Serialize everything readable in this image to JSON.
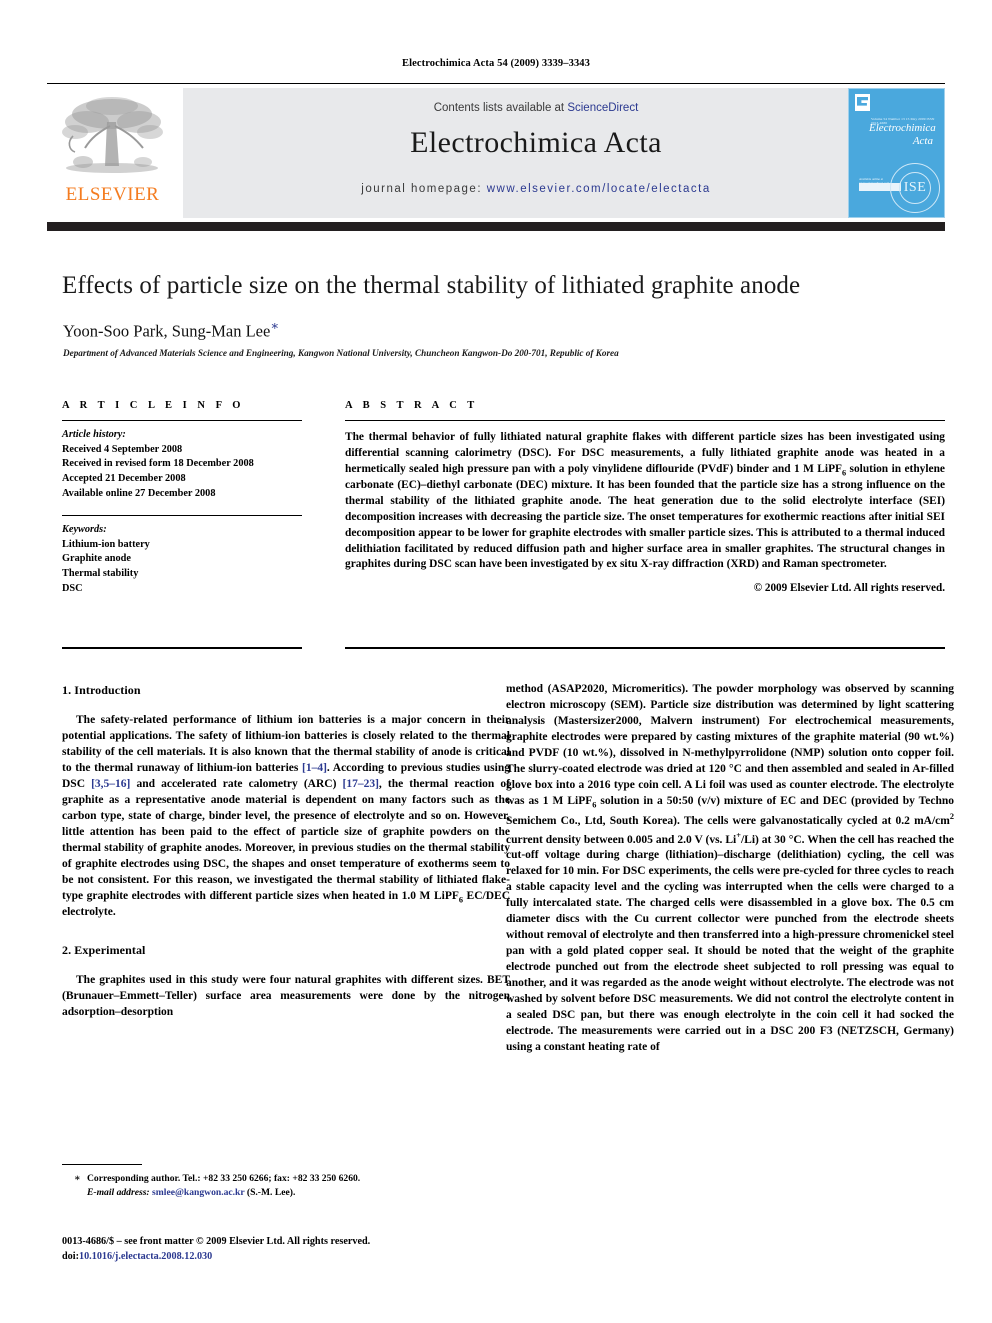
{
  "running_head": "Electrochimica Acta 54 (2009) 3339–3343",
  "masthead": {
    "contents_prefix": "Contents lists available at ",
    "sciencedirect": "ScienceDirect",
    "journal_name": "Electrochimica Acta",
    "homepage_prefix": "journal homepage:",
    "homepage_url": "www.elsevier.com/locate/electacta",
    "elsevier_wordmark": "ELSEVIER",
    "cover": {
      "tagline": "Volume 54  Number 13  15 May 2009  ISSN 0013-4686",
      "title_line1": "Electrochimica",
      "title_line2": "Acta",
      "sciencedirect_tag": "Available online at www.sciencedirect.com",
      "sciencedirect_box": "ScienceDirect",
      "seal_text": "ISE"
    },
    "accent_orange": "#f47c20",
    "accent_blue": "#2b3990",
    "band_gray": "#e8e9eb",
    "cover_blue": "#4aa8dd",
    "rule_black": "#231f20"
  },
  "article": {
    "title": "Effects of particle size on the thermal stability of lithiated graphite anode",
    "authors": "Yoon-Soo Park, Sung-Man Lee",
    "corresponding_marker": "∗",
    "affiliation": "Department of Advanced Materials Science and Engineering, Kangwon National University, Chuncheon Kangwon-Do 200-701, Republic of Korea"
  },
  "article_info": {
    "heading": "A R T I C L E   I N F O",
    "history_label": "Article history:",
    "history": [
      "Received 4 September 2008",
      "Received in revised form 18 December 2008",
      "Accepted 21 December 2008",
      "Available online 27 December 2008"
    ],
    "keywords_label": "Keywords:",
    "keywords": [
      "Lithium-ion battery",
      "Graphite anode",
      "Thermal stability",
      "DSC"
    ]
  },
  "abstract": {
    "heading": "A B S T R A C T",
    "text_part1": "The thermal behavior of fully lithiated natural graphite flakes with different particle sizes has been investigated using differential scanning calorimetry (DSC). For DSC measurements, a fully lithiated graphite anode was heated in a hermetically sealed high pressure pan with a poly vinylidene diflouride (PVdF) binder and 1 M LiPF",
    "subscript1": "6",
    "text_part2": " solution in ethylene carbonate (EC)–diethyl carbonate (DEC) mixture. It has been founded that the particle size has a strong influence on the thermal stability of the lithiated graphite anode. The heat generation due to the solid electrolyte interface (SEI) decomposition increases with decreasing the particle size. The onset temperatures for exothermic reactions after initial SEI decomposition appear to be lower for graphite electrodes with smaller particle sizes. This is attributed to a thermal induced delithiation facilitated by reduced diffusion path and higher surface area in smaller graphites. The structural changes in graphites during DSC scan have been investigated by ex situ X-ray diffraction (XRD) and Raman spectrometer.",
    "copyright": "© 2009 Elsevier Ltd. All rights reserved."
  },
  "body": {
    "section1_heading": "1.  Introduction",
    "section1_p1_a": "The safety-related performance of lithium ion batteries is a major concern in their potential applications. The safety of lithium-ion batteries is closely related to the thermal stability of the cell materials. It is also known that the thermal stability of anode is critical to the thermal runaway of lithium-ion batteries ",
    "ref1": "[1–4]",
    "section1_p1_b": ". According to previous studies using DSC ",
    "ref2": "[3,5–16]",
    "section1_p1_c": " and accelerated rate calometry (ARC) ",
    "ref3": "[17–23]",
    "section1_p1_d": ", the thermal reaction of graphite as a representative anode material is dependent on many factors such as the carbon type, state of charge, binder level, the presence of electrolyte and so on. However, little attention has been paid to the effect of particle size of graphite powders on the thermal stability of graphite anodes. Moreover, in previous studies on the thermal stability of graphite electrodes using DSC, the shapes and onset temperature of exotherms seem to be not consistent. For this reason, we investigated the thermal stability of lithiated flake-type graphite electrodes with different particle sizes when heated in 1.0 M LiPF",
    "sub6": "6",
    "section1_p1_e": " EC/DEC electrolyte.",
    "section2_heading": "2.  Experimental",
    "section2_p1": "The graphites used in this study were four natural graphites with different sizes. BET (Brunauer–Emmett–Teller) surface area measurements were done by the nitrogen adsorption–desorption",
    "right_p1_a": "method (ASAP2020, Micromeritics). The powder morphology was observed by scanning electron microscopy (SEM). Particle size distribution was determined by light scattering analysis (Mastersizer2000, Malvern instrument) For electrochemical measurements, graphite electrodes were prepared by casting mixtures of the graphite material (90 wt.%) and PVDF (10 wt.%), dissolved in N-methylpyrrolidone (NMP) solution onto copper foil. The slurry-coated electrode was dried at 120 °C and then assembled and sealed in Ar-filled glove box into a 2016 type coin cell. A Li foil was used as counter electrode. The electrolyte was as 1 M LiPF",
    "right_sub6a": "6",
    "right_p1_b": " solution in a 50:50 (v/v) mixture of EC and DEC (provided by Techno Semichem Co., Ltd, South Korea). The cells were galvanostatically cycled at 0.2 mA/cm",
    "right_sup2": "2",
    "right_p1_c": " current density between 0.005 and 2.0 V (vs. Li",
    "right_sup_plus": "+",
    "right_p1_d": "/Li) at 30 °C. When the cell has reached the cut-off voltage during charge (lithiation)–discharge (delithiation) cycling, the cell was relaxed for 10 min. For DSC experiments, the cells were pre-cycled for three cycles to reach a stable capacity level and the cycling was interrupted when the cells were charged to a fully intercalated state. The charged cells were disassembled in a glove box. The 0.5 cm diameter discs with the Cu current collector were punched from the electrode sheets without removal of electrolyte and then transferred into a high-pressure chromenickel steel pan with a gold plated copper seal. It should be noted that the weight of the graphite electrode punched out from the electrode sheet subjected to roll pressing was equal to another, and it was regarded as the anode weight without electrolyte. The electrode was not washed by solvent before DSC measurements. We did not control the electrolyte content in a sealed DSC pan, but there was enough electrolyte in the coin cell it had socked the electrode. The measurements were carried out in a DSC 200 F3 (NETZSCH, Germany) using a constant heating rate of"
  },
  "footnote": {
    "star": "∗",
    "corresponding": "Corresponding author. Tel.: +82 33 250 6266; fax: +82 33 250 6260.",
    "email_label": "E-mail address:",
    "email": "smlee@kangwon.ac.kr",
    "email_suffix": " (S.-M. Lee)."
  },
  "footer": {
    "issn_line": "0013-4686/$ – see front matter © 2009 Elsevier Ltd. All rights reserved.",
    "doi_label": "doi:",
    "doi_value": "10.1016/j.electacta.2008.12.030"
  }
}
